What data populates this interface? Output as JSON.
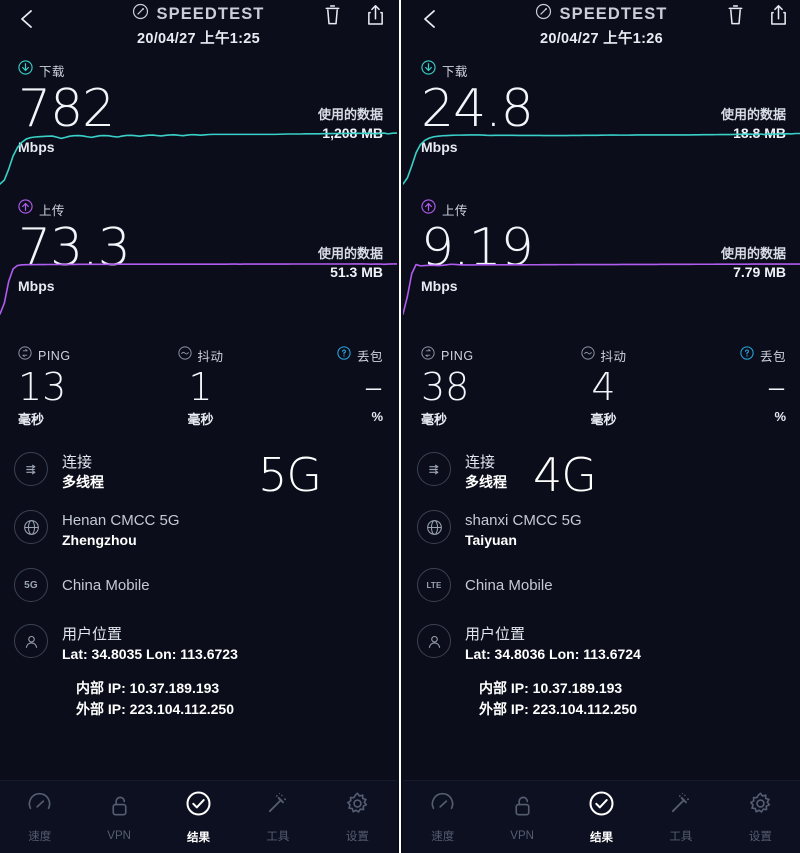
{
  "brand": {
    "name": "SPEEDTEST",
    "logo_icon": "speedometer-icon"
  },
  "header_icons": {
    "back": "back-arrow-icon",
    "delete": "trash-icon",
    "share": "share-icon"
  },
  "colors": {
    "background": "#0b0e1a",
    "download_accent": "#3ad0c8",
    "upload_accent": "#b05cf0",
    "loss_accent": "#2aa6e0",
    "divider": "#ffffff"
  },
  "panels": [
    {
      "timestamp": "20/04/27 上午1:25",
      "download": {
        "label": "下载",
        "value": "782",
        "unit": "Mbps",
        "data_used_label": "使用的数据",
        "data_used_value": "1,208 MB",
        "icon": "download-arrow-icon"
      },
      "upload": {
        "label": "上传",
        "value": "73.3",
        "unit": "Mbps",
        "data_used_label": "使用的数据",
        "data_used_value": "51.3 MB",
        "icon": "upload-arrow-icon"
      },
      "stats": [
        {
          "label": "PING",
          "value": "13",
          "unit": "毫秒",
          "icon": "ping-icon"
        },
        {
          "label": "抖动",
          "value": "1",
          "unit": "毫秒",
          "icon": "jitter-icon"
        },
        {
          "label": "丢包",
          "value": "–",
          "unit": "%",
          "icon": "help-icon"
        }
      ],
      "network_badge": "5G",
      "connection": {
        "title": "连接",
        "subtitle": "多线程",
        "icon": "multi-connection-icon"
      },
      "isp": {
        "title": "Henan CMCC 5G",
        "subtitle": "Zhengzhou",
        "icon": "globe-icon"
      },
      "carrier": {
        "title": "China Mobile",
        "badge": "5G",
        "icon": "network-type-icon"
      },
      "location": {
        "title": "用户位置",
        "coords": "Lat: 34.8035 Lon: 113.6723",
        "icon": "person-icon"
      },
      "ips": [
        {
          "label": "内部 IP:",
          "value": "10.37.189.193"
        },
        {
          "label": "外部 IP:",
          "value": "223.104.112.250"
        }
      ],
      "chart_data": [
        {
          "type": "line",
          "title": "下载",
          "series_name": "download",
          "color": "#3ad0c8",
          "unit": "Mbps",
          "final_value": 782,
          "ylim": [
            0,
            860
          ],
          "values": [
            0,
            60,
            230,
            430,
            560,
            640,
            690,
            712,
            722,
            726,
            730,
            734,
            736,
            720,
            700,
            716,
            734,
            742,
            744,
            738,
            726,
            716,
            730,
            742,
            744,
            740,
            728,
            722,
            736,
            746,
            748,
            742,
            734,
            742,
            750,
            752,
            744,
            738,
            748,
            754,
            756,
            748,
            742,
            752,
            758,
            756,
            750,
            756,
            760,
            762,
            762,
            762,
            762,
            762,
            762,
            762,
            762,
            762,
            762,
            762,
            762,
            762,
            762,
            762,
            764,
            766,
            768,
            768,
            768,
            768,
            770,
            770,
            770,
            770,
            772,
            772,
            774,
            774,
            774,
            776,
            776,
            776,
            778,
            778,
            778,
            780,
            768,
            776,
            782,
            770,
            780,
            782
          ]
        },
        {
          "type": "line",
          "title": "上传",
          "series_name": "upload",
          "color": "#b05cf0",
          "unit": "Mbps",
          "final_value": 73.3,
          "ylim": [
            0,
            82
          ],
          "values": [
            0,
            16,
            48,
            66,
            71,
            72,
            72.2,
            72.3,
            72.3,
            72.4,
            72.4,
            72.5,
            72.5,
            72.5,
            72.6,
            72.6,
            72.6,
            72.6,
            72.7,
            72.7,
            72.7,
            72.7,
            72.8,
            72.8,
            72.8,
            72.8,
            72.8,
            72.9,
            72.9,
            72.9,
            72.9,
            72.9,
            73,
            73,
            73,
            73,
            73,
            73,
            73,
            73,
            73,
            73,
            73,
            73,
            73,
            73,
            73,
            73,
            73,
            73,
            73,
            73,
            73,
            73.1,
            73.1,
            73,
            73.1,
            73.1,
            73.1,
            73.1,
            73.1,
            73.1,
            73.1,
            73.1,
            73.1,
            73.1,
            73.1,
            73.2,
            73.2,
            73.2,
            73.2,
            73.2,
            73.2,
            73.2,
            73.2,
            73.2,
            73.2,
            73.2,
            73.2,
            73.2,
            73.2,
            73.3,
            73.3,
            73.3,
            73.2,
            72.9,
            73.1,
            73.2,
            72.8,
            73.1,
            73.3,
            73.3
          ]
        }
      ]
    },
    {
      "timestamp": "20/04/27 上午1:26",
      "download": {
        "label": "下载",
        "value": "24.8",
        "unit": "Mbps",
        "data_used_label": "使用的数据",
        "data_used_value": "18.8 MB",
        "icon": "download-arrow-icon"
      },
      "upload": {
        "label": "上传",
        "value": "9.19",
        "unit": "Mbps",
        "data_used_label": "使用的数据",
        "data_used_value": "7.79 MB",
        "icon": "upload-arrow-icon"
      },
      "stats": [
        {
          "label": "PING",
          "value": "38",
          "unit": "毫秒",
          "icon": "ping-icon"
        },
        {
          "label": "抖动",
          "value": "4",
          "unit": "毫秒",
          "icon": "jitter-icon"
        },
        {
          "label": "丢包",
          "value": "–",
          "unit": "%",
          "icon": "help-icon"
        }
      ],
      "network_badge": "4G",
      "connection": {
        "title": "连接",
        "subtitle": "多线程",
        "icon": "multi-connection-icon"
      },
      "isp": {
        "title": "shanxi CMCC 5G",
        "subtitle": "Taiyuan",
        "icon": "globe-icon"
      },
      "carrier": {
        "title": "China Mobile",
        "badge": "LTE",
        "icon": "network-type-icon"
      },
      "location": {
        "title": "用户位置",
        "coords": "Lat: 34.8036 Lon: 113.6724",
        "icon": "person-icon"
      },
      "ips": [
        {
          "label": "内部 IP:",
          "value": "10.37.189.193"
        },
        {
          "label": "外部 IP:",
          "value": "223.104.112.250"
        }
      ],
      "chart_data": [
        {
          "type": "line",
          "title": "下载",
          "series_name": "download",
          "color": "#3ad0c8",
          "unit": "Mbps",
          "final_value": 24.8,
          "ylim": [
            0,
            27.5
          ],
          "values": [
            0,
            3,
            9,
            15.5,
            19.5,
            21.5,
            22.6,
            23.2,
            23.5,
            23.7,
            23.8,
            23.9,
            24,
            24,
            24.05,
            24.1,
            24.1,
            24.1,
            24.05,
            23.9,
            23.85,
            23.9,
            23.9,
            23.9,
            23.9,
            23.9,
            23.85,
            23.85,
            23.85,
            23.85,
            23.85,
            23.85,
            23.8,
            23.8,
            23.8,
            23.8,
            23.8,
            23.8,
            23.85,
            23.85,
            23.85,
            23.9,
            23.9,
            23.9,
            23.9,
            23.95,
            24,
            24.05,
            24.05,
            24,
            24,
            24,
            24.05,
            24.1,
            24.1,
            24.1,
            24.1,
            24.1,
            24.1,
            24.1,
            24.1,
            24.1,
            24.1,
            24.1,
            24.1,
            24.1,
            24.15,
            24.15,
            24.2,
            24.2,
            24.2,
            24.25,
            24.3,
            24.3,
            24.3,
            24.35,
            24.4,
            24.4,
            24.45,
            24.5,
            24.2,
            24.55,
            24.3,
            24.6,
            24.35,
            24.65,
            24.5,
            24.7,
            24.6,
            24.8,
            24.8
          ]
        },
        {
          "type": "line",
          "title": "上传",
          "series_name": "upload",
          "color": "#b05cf0",
          "unit": "Mbps",
          "final_value": 9.19,
          "ylim": [
            0,
            10.3
          ],
          "values": [
            0,
            3.2,
            7.4,
            9.1,
            8.85,
            8.9,
            8.95,
            8.95,
            8.9,
            8.95,
            9.05,
            9.15,
            9.12,
            9.05,
            9.02,
            9.02,
            9.03,
            9.05,
            9.05,
            9.05,
            9.05,
            9.05,
            9.05,
            9.05,
            9.05,
            9.05,
            9.05,
            9.05,
            9.05,
            9.06,
            9.06,
            9.06,
            9.07,
            9.07,
            9.07,
            9.07,
            9.08,
            9.08,
            9.08,
            9.08,
            9.09,
            9.09,
            9.09,
            9.1,
            9.1,
            9.1,
            9.1,
            9.1,
            9.1,
            9.1,
            9.11,
            9.11,
            9.11,
            9.11,
            9.12,
            9.12,
            9.12,
            9.12,
            9.12,
            9.13,
            9.13,
            9.13,
            9.13,
            9.14,
            9.14,
            9.14,
            9.14,
            9.15,
            9.15,
            9.15,
            9.15,
            9.15,
            9.16,
            9.16,
            9.16,
            9.16,
            9.17,
            9.17,
            9.17,
            9.17,
            9.18,
            9.18,
            9.18,
            9.18,
            9.18,
            9.19,
            9.19,
            9.19,
            9.19,
            9.19,
            9.19,
            9.19
          ]
        }
      ]
    }
  ],
  "navbar": {
    "items": [
      {
        "label": "速度",
        "icon": "speedometer-icon",
        "active": false
      },
      {
        "label": "VPN",
        "icon": "lock-icon",
        "active": false
      },
      {
        "label": "结果",
        "icon": "check-circle-icon",
        "active": true
      },
      {
        "label": "工具",
        "icon": "magic-wand-icon",
        "active": false
      },
      {
        "label": "设置",
        "icon": "gear-icon",
        "active": false
      }
    ]
  }
}
